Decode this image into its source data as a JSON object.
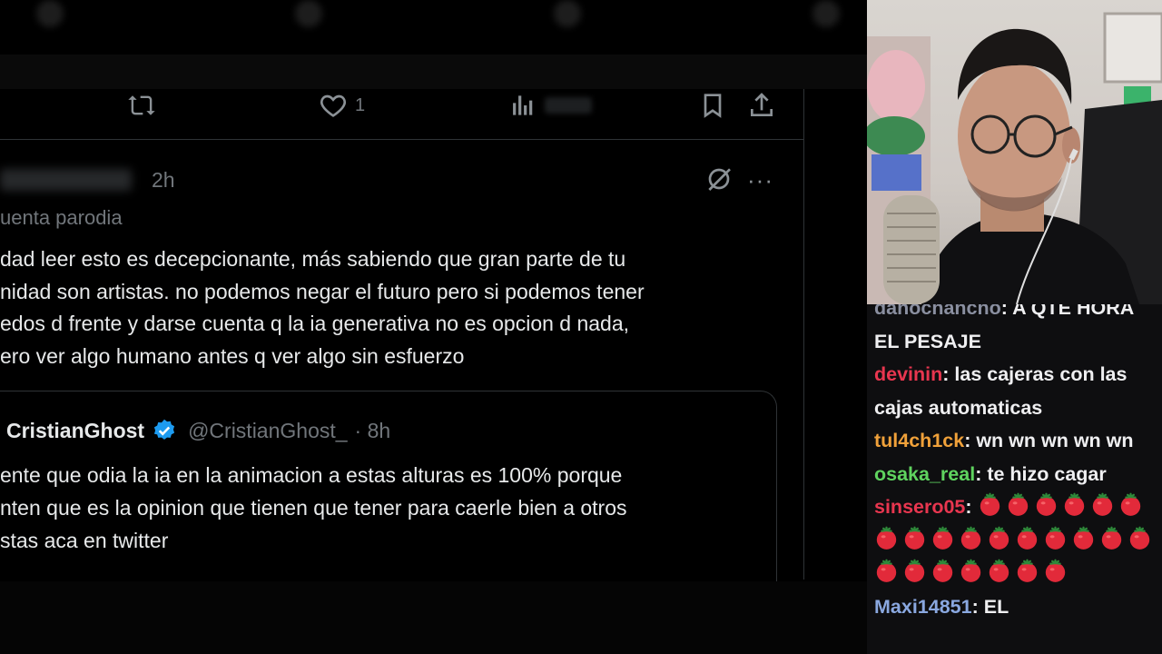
{
  "tweet_actions": {
    "like_count": "1"
  },
  "tweet": {
    "timestamp": "2h",
    "label": "uenta parodia",
    "lines": [
      "dad leer esto es decepcionante, más sabiendo que gran parte de tu",
      "nidad son artistas. no podemos negar el futuro pero si podemos tener",
      "edos d frente y darse cuenta q la ia generativa no es opcion d nada,",
      "ero ver algo humano antes q ver algo sin esfuerzo"
    ]
  },
  "quoted_tweet": {
    "name": "CristianGhost",
    "handle": "@CristianGhost_",
    "time": "· 8h",
    "lines": [
      "ente que odia la ia en la animacion a estas alturas es 100% porque",
      "nten que es la opinion que tienen que tener para caerle bien a otros",
      "stas aca en twitter"
    ]
  },
  "chat": {
    "messages": [
      {
        "user": "danochancho",
        "color": "#8a8fa0",
        "text": "A QTE HORA EL PESAJE"
      },
      {
        "user": "devinin",
        "color": "#e8364f",
        "text": "las cajeras con las cajas automaticas"
      },
      {
        "user": "tul4ch1ck",
        "color": "#f0a13a",
        "text": "wn wn wn wn wn"
      },
      {
        "user": "osaka_real",
        "color": "#5fd35f",
        "text": "te hizo cagar"
      },
      {
        "user": "sinsero05",
        "color": "#e8364f",
        "text": "",
        "tomatoes": 23
      },
      {
        "user": "Maxi14851",
        "color": "#8aa8e0",
        "text": "EL"
      }
    ]
  },
  "colors": {
    "accent_verified": "#1d9bf0",
    "chat_bg": "#0e0e10",
    "text_secondary": "#71767b"
  }
}
